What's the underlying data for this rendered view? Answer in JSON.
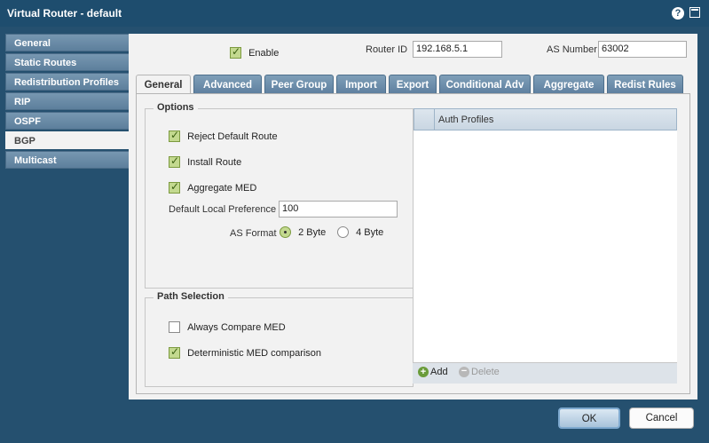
{
  "window": {
    "title": "Virtual Router - default"
  },
  "sidebar": {
    "items": [
      {
        "label": "General"
      },
      {
        "label": "Static Routes"
      },
      {
        "label": "Redistribution Profiles"
      },
      {
        "label": "RIP"
      },
      {
        "label": "OSPF"
      },
      {
        "label": "BGP",
        "active": true
      },
      {
        "label": "Multicast"
      }
    ]
  },
  "header": {
    "enable_label": "Enable",
    "enable_checked": true,
    "router_id_label": "Router ID",
    "router_id_value": "192.168.5.1",
    "as_number_label": "AS Number",
    "as_number_value": "63002"
  },
  "tabs": [
    {
      "label": "General",
      "active": true
    },
    {
      "label": "Advanced"
    },
    {
      "label": "Peer Group"
    },
    {
      "label": "Import"
    },
    {
      "label": "Export"
    },
    {
      "label": "Conditional Adv"
    },
    {
      "label": "Aggregate"
    },
    {
      "label": "Redist Rules"
    }
  ],
  "options": {
    "title": "Options",
    "reject_default_route": {
      "label": "Reject Default Route",
      "checked": true
    },
    "install_route": {
      "label": "Install Route",
      "checked": true
    },
    "aggregate_med": {
      "label": "Aggregate MED",
      "checked": true
    },
    "default_local_pref_label": "Default Local Preference",
    "default_local_pref_value": "100",
    "as_format_label": "AS Format",
    "as_format_2byte": "2 Byte",
    "as_format_4byte": "4 Byte",
    "as_format_selected": "2 Byte"
  },
  "path_selection": {
    "title": "Path Selection",
    "always_compare_med": {
      "label": "Always Compare MED",
      "checked": false
    },
    "deterministic_med": {
      "label": "Deterministic MED comparison",
      "checked": true
    }
  },
  "auth_profiles": {
    "column": "Auth Profiles",
    "add_label": "Add",
    "delete_label": "Delete"
  },
  "footer": {
    "ok_label": "OK",
    "cancel_label": "Cancel"
  },
  "colors": {
    "chrome": "#25506f",
    "accent_green": "#c3d98f",
    "panel": "#f2f2f2"
  }
}
